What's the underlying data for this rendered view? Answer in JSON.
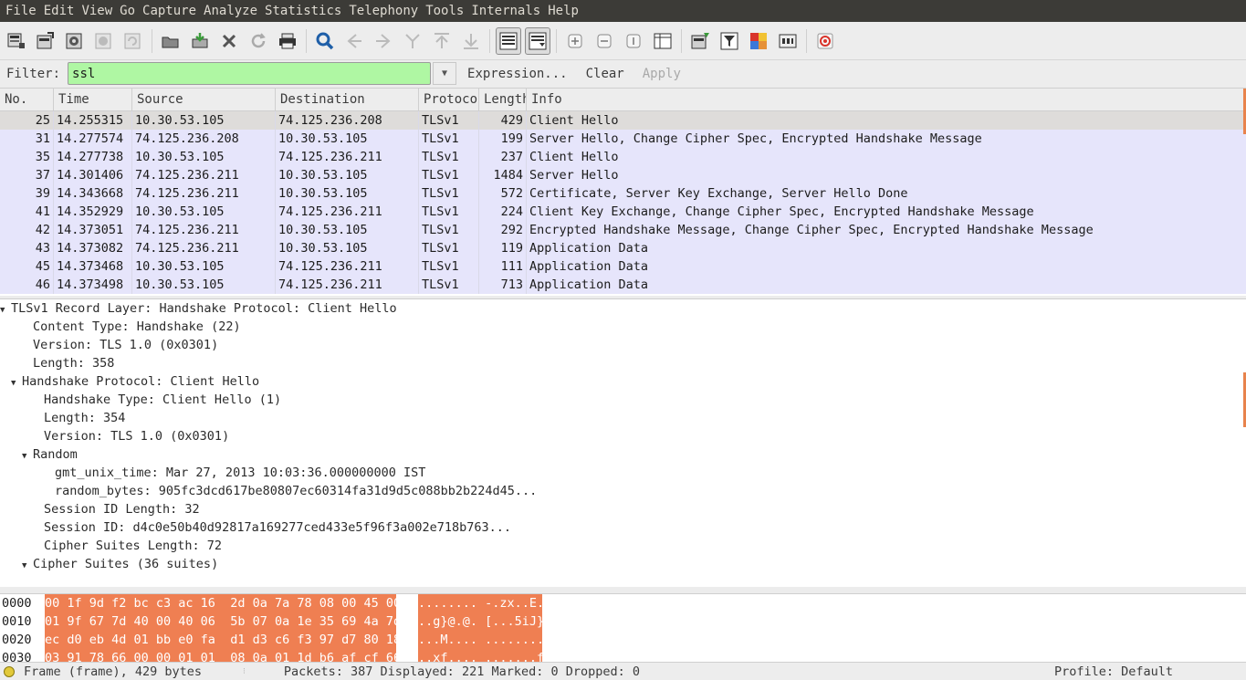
{
  "menubar": {
    "items": [
      "File",
      "Edit",
      "View",
      "Go",
      "Capture",
      "Analyze",
      "Statistics",
      "Telephony",
      "Tools",
      "Internals",
      "Help"
    ]
  },
  "toolbar": {
    "icons": [
      "interface-list-icon",
      "capture-options-icon",
      "start-capture-icon",
      "stop-capture-icon",
      "restart-capture-icon",
      "open-file-icon",
      "save-file-icon",
      "close-file-icon",
      "reload-icon",
      "print-icon",
      "find-packet-icon",
      "go-back-icon",
      "go-forward-icon",
      "go-to-packet-icon",
      "go-first-icon",
      "go-last-icon",
      "colorize-icon",
      "auto-scroll-icon",
      "zoom-in-icon",
      "zoom-out-icon",
      "normal-size-icon",
      "resize-columns-icon",
      "capture-filters-icon",
      "display-filters-icon",
      "coloring-rules-icon",
      "preferences-icon",
      "help-icon"
    ]
  },
  "filter": {
    "label": "Filter:",
    "value": "ssl",
    "expression_label": "Expression...",
    "clear_label": "Clear",
    "apply_label": "Apply"
  },
  "packet_list": {
    "columns": [
      "No.",
      "Time",
      "Source",
      "Destination",
      "Protocol",
      "Length",
      "Info"
    ],
    "rows": [
      {
        "no": "25",
        "time": "14.255315",
        "source": "10.30.53.105",
        "destination": "74.125.236.208",
        "protocol": "TLSv1",
        "length": "429",
        "info": "Client Hello"
      },
      {
        "no": "31",
        "time": "14.277574",
        "source": "74.125.236.208",
        "destination": "10.30.53.105",
        "protocol": "TLSv1",
        "length": "199",
        "info": "Server Hello, Change Cipher Spec, Encrypted Handshake Message"
      },
      {
        "no": "35",
        "time": "14.277738",
        "source": "10.30.53.105",
        "destination": "74.125.236.211",
        "protocol": "TLSv1",
        "length": "237",
        "info": "Client Hello"
      },
      {
        "no": "37",
        "time": "14.301406",
        "source": "74.125.236.211",
        "destination": "10.30.53.105",
        "protocol": "TLSv1",
        "length": "1484",
        "info": "Server Hello"
      },
      {
        "no": "39",
        "time": "14.343668",
        "source": "74.125.236.211",
        "destination": "10.30.53.105",
        "protocol": "TLSv1",
        "length": "572",
        "info": "Certificate, Server Key Exchange, Server Hello Done"
      },
      {
        "no": "41",
        "time": "14.352929",
        "source": "10.30.53.105",
        "destination": "74.125.236.211",
        "protocol": "TLSv1",
        "length": "224",
        "info": "Client Key Exchange, Change Cipher Spec, Encrypted Handshake Message"
      },
      {
        "no": "42",
        "time": "14.373051",
        "source": "74.125.236.211",
        "destination": "10.30.53.105",
        "protocol": "TLSv1",
        "length": "292",
        "info": "Encrypted Handshake Message, Change Cipher Spec, Encrypted Handshake Message"
      },
      {
        "no": "43",
        "time": "14.373082",
        "source": "74.125.236.211",
        "destination": "10.30.53.105",
        "protocol": "TLSv1",
        "length": "119",
        "info": "Application Data"
      },
      {
        "no": "45",
        "time": "14.373468",
        "source": "10.30.53.105",
        "destination": "74.125.236.211",
        "protocol": "TLSv1",
        "length": "111",
        "info": "Application Data"
      },
      {
        "no": "46",
        "time": "14.373498",
        "source": "10.30.53.105",
        "destination": "74.125.236.211",
        "protocol": "TLSv1",
        "length": "713",
        "info": "Application Data"
      }
    ]
  },
  "details": {
    "lines": [
      {
        "text": "TLSv1 Record Layer: Handshake Protocol: Client Hello",
        "expander": "expanded"
      },
      {
        "text": "Content Type: Handshake (22)",
        "expander": "none"
      },
      {
        "text": "Version: TLS 1.0 (0x0301)",
        "expander": "none"
      },
      {
        "text": "Length: 358",
        "expander": "none"
      },
      {
        "text": "Handshake Protocol: Client Hello",
        "expander": "expanded"
      },
      {
        "text": "Handshake Type: Client Hello (1)",
        "expander": "none"
      },
      {
        "text": "Length: 354",
        "expander": "none"
      },
      {
        "text": "Version: TLS 1.0 (0x0301)",
        "expander": "none"
      },
      {
        "text": "Random",
        "expander": "expanded"
      },
      {
        "text": "gmt_unix_time: Mar 27, 2013 10:03:36.000000000 IST",
        "expander": "none"
      },
      {
        "text": "random_bytes: 905fc3dcd617be80807ec60314fa31d9d5c088bb2b224d45...",
        "expander": "none"
      },
      {
        "text": "Session ID Length: 32",
        "expander": "none"
      },
      {
        "text": "Session ID: d4c0e50b40d92817a169277ced433e5f96f3a002e718b763...",
        "expander": "none"
      },
      {
        "text": "Cipher Suites Length: 72",
        "expander": "none"
      },
      {
        "text": "Cipher Suites (36 suites)",
        "expander": "expanded"
      }
    ]
  },
  "bytes": {
    "rows": [
      {
        "offset": "0000",
        "hex": "00 1f 9d f2 bc c3 ac 16  2d 0a 7a 78 08 00 45 00",
        "ascii": "........ -.zx..E."
      },
      {
        "offset": "0010",
        "hex": "01 9f 67 7d 40 00 40 06  5b 07 0a 1e 35 69 4a 7d",
        "ascii": "..g}@.@. [...5iJ}"
      },
      {
        "offset": "0020",
        "hex": "ec d0 eb 4d 01 bb e0 fa  d1 d3 c6 f3 97 d7 80 18",
        "ascii": "...M.... ........"
      },
      {
        "offset": "0030",
        "hex": "03 91 78 66 00 00 01 01  08 0a 01 1d b6 af cf 66",
        "ascii": "..xf.... .......f"
      }
    ]
  },
  "status": {
    "frame": "Frame (frame), 429 bytes",
    "packets": "Packets: 387 Displayed: 221 Marked: 0 Dropped: 0",
    "profile": "Profile: Default"
  },
  "colors": {
    "filter_valid": "#aff7a3",
    "row_tls": "#e6e5fb",
    "row_selected": "#dedcda",
    "bytes_highlight": "#ef7f52",
    "menubar_bg": "#3c3b37"
  }
}
